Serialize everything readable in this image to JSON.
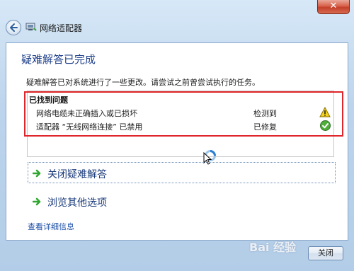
{
  "window": {
    "title": "网络适配器",
    "close_glyph": "✕"
  },
  "content": {
    "heading": "疑难解答已完成",
    "description": "疑难解答已对系统进行了一些更改。请尝试之前曾尝试执行的任务。",
    "problems_title": "已找到问题",
    "problems": [
      {
        "text": "网络电缆未正确插入或已损坏",
        "status": "检测到",
        "status_icon": "warning-icon"
      },
      {
        "text": "适配器 “无线网络连接” 已禁用",
        "status": "已修复",
        "status_icon": "check-icon"
      }
    ]
  },
  "actions": [
    {
      "label": "关闭疑难解答",
      "icon": "green-arrow-icon"
    },
    {
      "label": "浏览其他选项",
      "icon": "green-arrow-icon"
    }
  ],
  "details_link": "查看详细信息",
  "footer": {
    "close_button": "关闭"
  },
  "watermark": "Bai 经验",
  "colors": {
    "heading": "#1e3f8a",
    "highlight_border": "#e0262a",
    "link": "#1c4fa8",
    "arrow": "#2fa62f"
  }
}
